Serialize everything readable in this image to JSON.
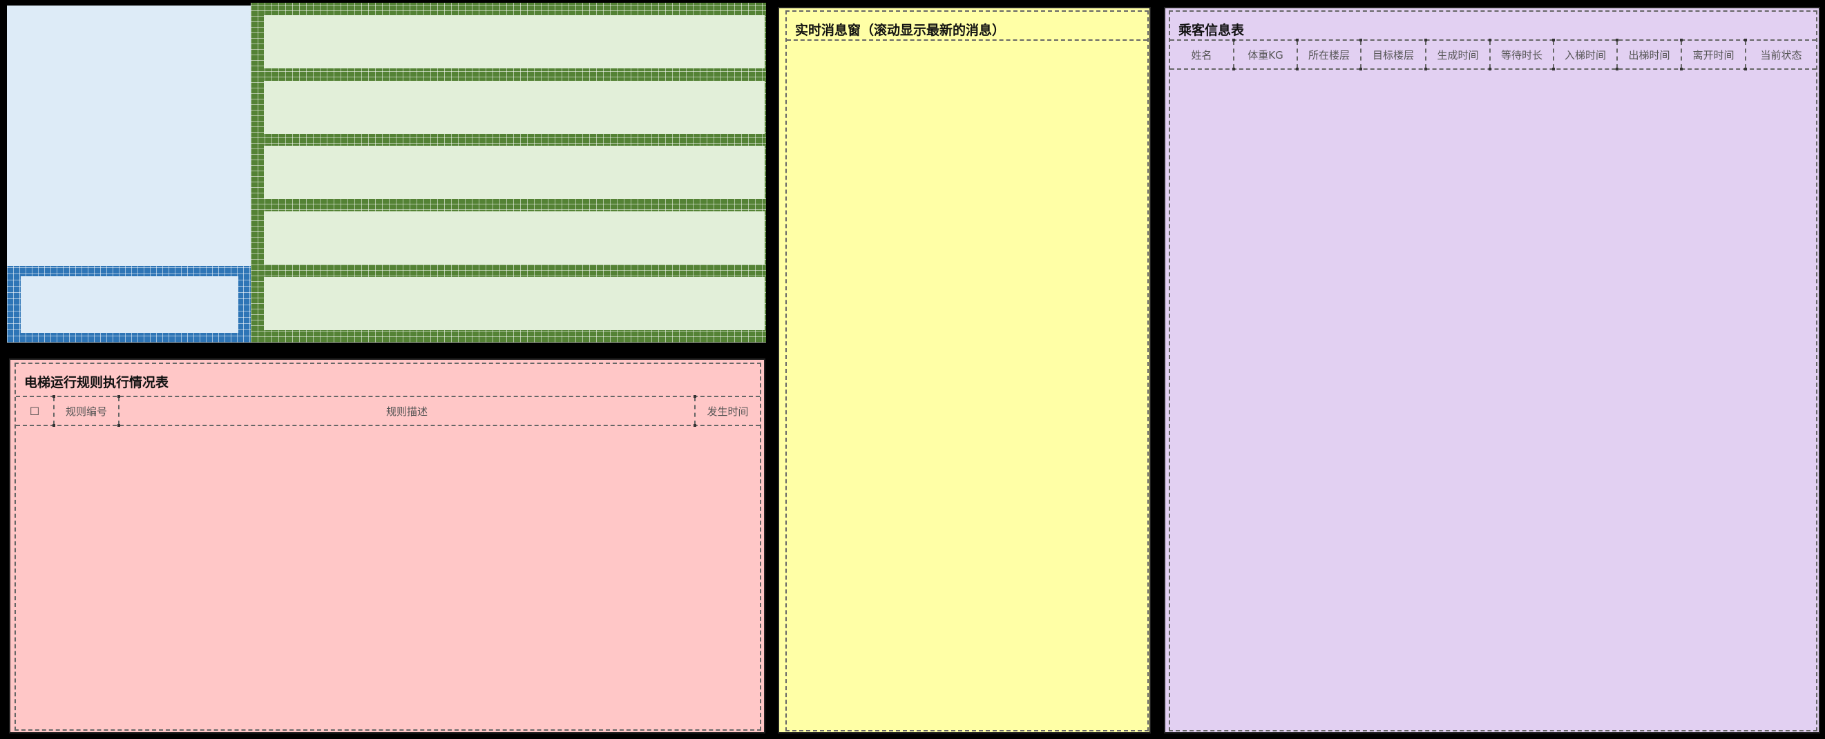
{
  "rules_panel": {
    "title": "电梯运行规则执行情况表",
    "columns": {
      "checkbox": "☐",
      "rule_id": "规则编号",
      "rule_desc": "规则描述",
      "occur_time": "发生时间"
    },
    "rows": []
  },
  "message_panel": {
    "title": "实时消息窗（滚动显示最新的消息）",
    "messages": []
  },
  "passenger_panel": {
    "title": "乘客信息表",
    "columns": [
      "姓名",
      "体重KG",
      "所在楼层",
      "目标楼层",
      "生成时间",
      "等待时长",
      "入梯时间",
      "出梯时间",
      "离开时间",
      "当前状态"
    ],
    "rows": []
  },
  "colors": {
    "shaft_fill": "#ddebf7",
    "shaft_border": "#2e75b6",
    "floor_fill": "#e2efd9",
    "floor_border": "#548235",
    "rules_bg": "#ffc7c7",
    "message_bg": "#ffffa6",
    "passenger_bg": "#e2d0f2"
  }
}
